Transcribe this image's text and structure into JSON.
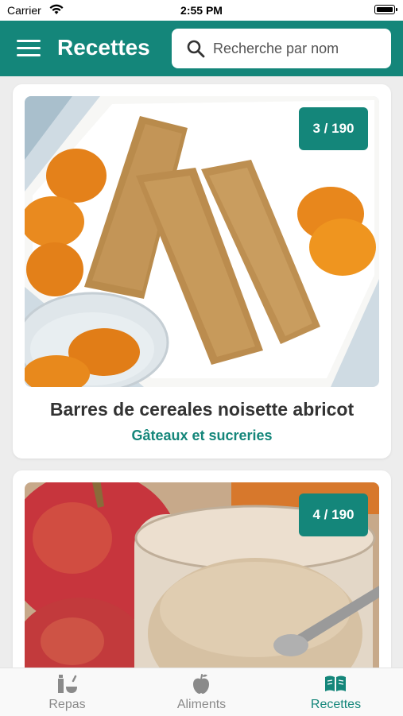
{
  "status_bar": {
    "carrier": "Carrier",
    "time": "2:55 PM"
  },
  "header": {
    "title": "Recettes",
    "search_placeholder": "Recherche par nom"
  },
  "recipes": [
    {
      "counter": "3 / 190",
      "title": "Barres de cereales noisette abricot",
      "category": "Gâteaux et sucreries"
    },
    {
      "counter": "4 / 190",
      "title": "",
      "category": ""
    }
  ],
  "tabs": [
    {
      "label": "Repas",
      "icon": "meal-icon",
      "active": false
    },
    {
      "label": "Aliments",
      "icon": "apple-icon",
      "active": false
    },
    {
      "label": "Recettes",
      "icon": "book-icon",
      "active": true
    }
  ],
  "colors": {
    "brand": "#14867a",
    "inactive": "#8a8a8a",
    "background": "#ededed"
  }
}
